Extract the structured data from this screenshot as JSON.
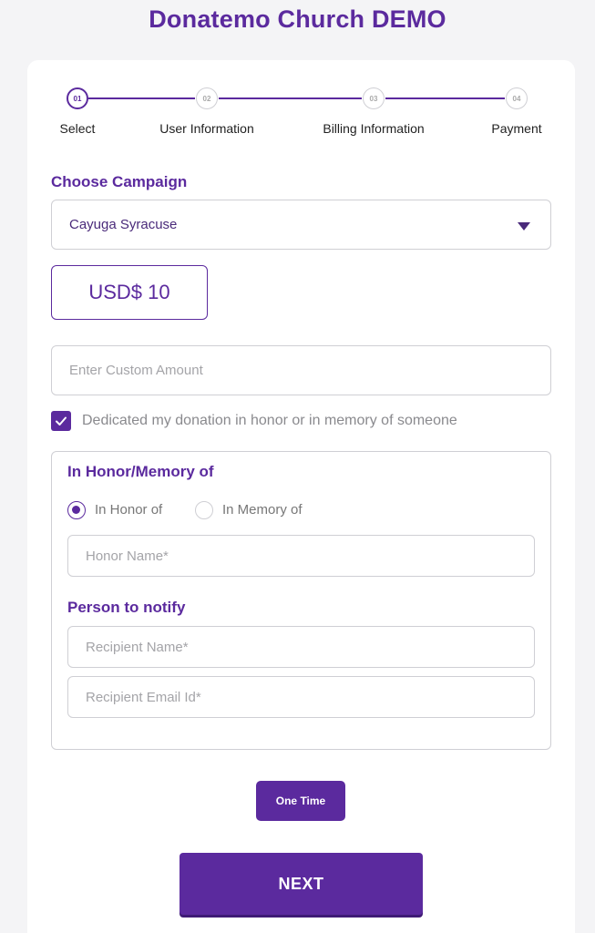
{
  "header": {
    "title": "Donatemo Church DEMO"
  },
  "stepper": {
    "steps": [
      {
        "number": "01",
        "label": "Select"
      },
      {
        "number": "02",
        "label": "User Information"
      },
      {
        "number": "03",
        "label": "Billing Information"
      },
      {
        "number": "04",
        "label": "Payment"
      }
    ]
  },
  "campaign": {
    "title": "Choose Campaign",
    "selected": "Cayuga Syracuse"
  },
  "amount": {
    "preset_label": "USD$ 10",
    "custom_placeholder": "Enter Custom Amount"
  },
  "dedication": {
    "checkbox_label": "Dedicated my donation in honor or in memory of someone",
    "checked": true
  },
  "honor": {
    "title": "In Honor/Memory of",
    "option_honor": "In Honor of",
    "option_memory": "In Memory of",
    "selected": "In Honor of",
    "name_placeholder": "Honor Name*"
  },
  "notify": {
    "title": "Person to notify",
    "recipient_name_placeholder": "Recipient Name*",
    "recipient_email_placeholder": "Recipient Email Id*"
  },
  "frequency": {
    "label": "One Time"
  },
  "actions": {
    "next_label": "NEXT"
  },
  "colors": {
    "accent": "#5b2a9e",
    "border": "#cfcfd4",
    "background": "#f4f4f6"
  }
}
